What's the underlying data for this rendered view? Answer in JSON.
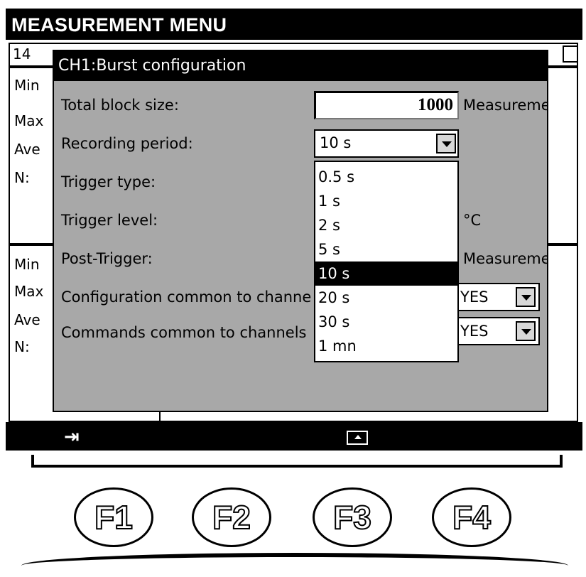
{
  "screen": {
    "title": "MEASUREMENT MENU",
    "subheader_text": "14",
    "panel1_labels": [
      "Min",
      "Max",
      "Ave",
      "N:"
    ],
    "panel2_labels": [
      "Min",
      "Max",
      "Ave",
      "N:"
    ]
  },
  "dialog": {
    "title": "CH1:Burst configuration",
    "rows": [
      {
        "label": "Total block size:",
        "value": "1000",
        "unit": "Measurements"
      },
      {
        "label": "Recording period:",
        "value": "10 s"
      },
      {
        "label": "Trigger type:"
      },
      {
        "label": "Trigger level:",
        "unit": "°C"
      },
      {
        "label": "Post-Trigger:",
        "unit": "Measurements"
      },
      {
        "label": "Configuration common to channels",
        "value": "YES"
      },
      {
        "label": "Commands common to channels",
        "value": "YES"
      }
    ]
  },
  "dropdown": {
    "options": [
      "0.5 s",
      "1 s",
      "2 s",
      "5 s",
      "10 s",
      "20 s",
      "30 s",
      "1 mn"
    ],
    "selected_index": 4
  },
  "softkeys": {
    "key1_icon": "tab-arrow-icon",
    "key1_glyph": "⇥",
    "key3_icon": "up-triangle-icon"
  },
  "function_keys": [
    "F1",
    "F2",
    "F3",
    "F4"
  ]
}
